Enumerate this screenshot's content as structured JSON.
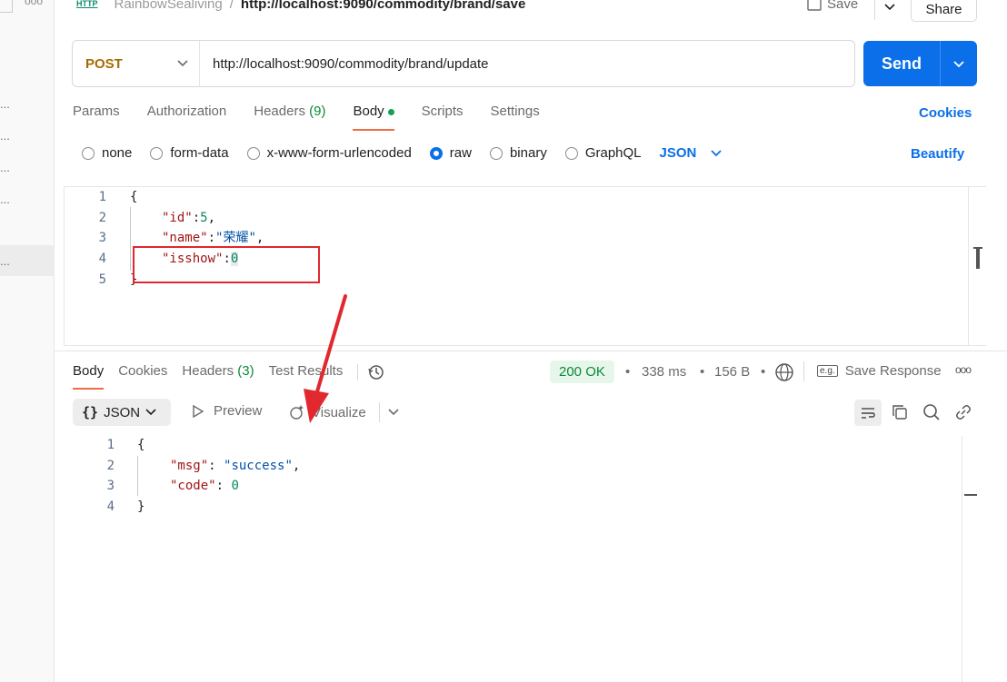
{
  "header": {
    "collection": "RainbowSealiving",
    "separator": "/",
    "request_name": "http://localhost:9090/commodity/brand/save",
    "save_label": "Save",
    "share_label": "Share",
    "http_badge": "HTTP"
  },
  "request": {
    "method": "POST",
    "url": "http://localhost:9090/commodity/brand/update",
    "send_label": "Send"
  },
  "tabs": {
    "params": "Params",
    "authorization": "Authorization",
    "headers": "Headers",
    "headers_count": "(9)",
    "body": "Body",
    "scripts": "Scripts",
    "settings": "Settings",
    "cookies": "Cookies"
  },
  "body_types": {
    "none": "none",
    "form_data": "form-data",
    "urlencoded": "x-www-form-urlencoded",
    "raw": "raw",
    "binary": "binary",
    "graphql": "GraphQL",
    "format": "JSON",
    "beautify": "Beautify"
  },
  "request_body": {
    "line_numbers": [
      "1",
      "2",
      "3",
      "4",
      "5"
    ],
    "open": "{",
    "k1": "\"id\"",
    "v1": "5",
    "c1": ",",
    "k2": "\"name\"",
    "v2": "\"荣耀\"",
    "c2": ",",
    "k3": "\"isshow\"",
    "v3": "0",
    "close": "}",
    "colon": ":"
  },
  "response": {
    "tab_body": "Body",
    "tab_cookies": "Cookies",
    "tab_headers": "Headers",
    "tab_headers_count": "(3)",
    "tab_test_results": "Test Results",
    "status": "200 OK",
    "time": "338 ms",
    "size": "156 B",
    "save_response": "Save Response",
    "format": "JSON",
    "preview": "Preview",
    "visualize": "Visualize",
    "line_numbers": [
      "1",
      "2",
      "3",
      "4"
    ],
    "open": "{",
    "k1": "\"msg\"",
    "v1": "\"success\"",
    "c1": ",",
    "k2": "\"code\"",
    "v2": "0",
    "close": "}",
    "colon": ": "
  },
  "sidebar": {
    "ellipsis": "..."
  },
  "colors": {
    "accent": "#0a6fe8",
    "tab_underline": "#f06d43",
    "method": "#a66b00",
    "annotation": "#e0282e"
  }
}
